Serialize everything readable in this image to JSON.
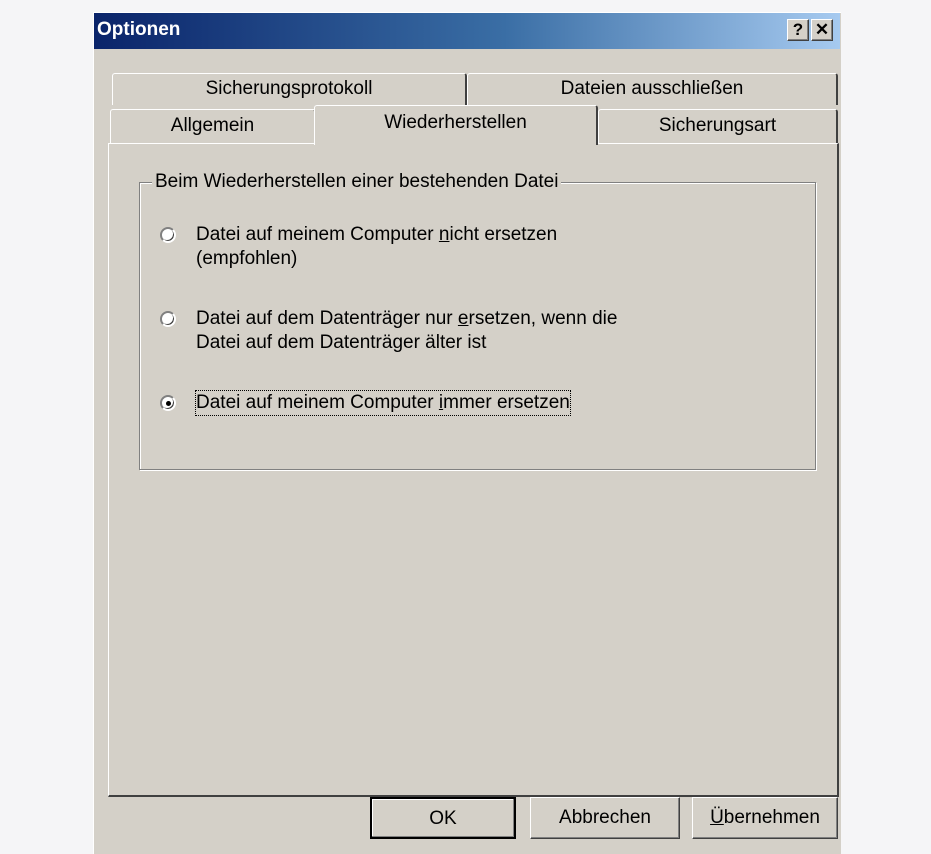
{
  "window": {
    "title": "Optionen",
    "help_button": "?",
    "close_button": "✕"
  },
  "tabs": {
    "back_row": [
      {
        "label": "Sicherungsprotokoll"
      },
      {
        "label": "Dateien ausschließen"
      }
    ],
    "front_row": [
      {
        "label": "Allgemein"
      },
      {
        "label": "Wiederherstellen",
        "active": true
      },
      {
        "label": "Sicherungsart"
      }
    ]
  },
  "group": {
    "title": "Beim Wiederherstellen einer bestehenden Datei",
    "options": [
      {
        "line1_pre": "Datei auf meinem Computer ",
        "line1_mnemonic": "n",
        "line1_post": "icht ersetzen",
        "line2": "(empfohlen)",
        "selected": false
      },
      {
        "line1_pre": "Datei auf dem Datenträger nur ",
        "line1_mnemonic": "e",
        "line1_post": "rsetzen, wenn die",
        "line2": "Datei auf dem Datenträger älter ist",
        "selected": false
      },
      {
        "line1_pre": "Datei auf meinem Computer ",
        "line1_mnemonic": "i",
        "line1_post": "mmer ersetzen",
        "line2": "",
        "selected": true
      }
    ]
  },
  "buttons": {
    "ok": "OK",
    "cancel": "Abbrechen",
    "apply_mnemonic": "Ü",
    "apply_rest": "bernehmen"
  }
}
